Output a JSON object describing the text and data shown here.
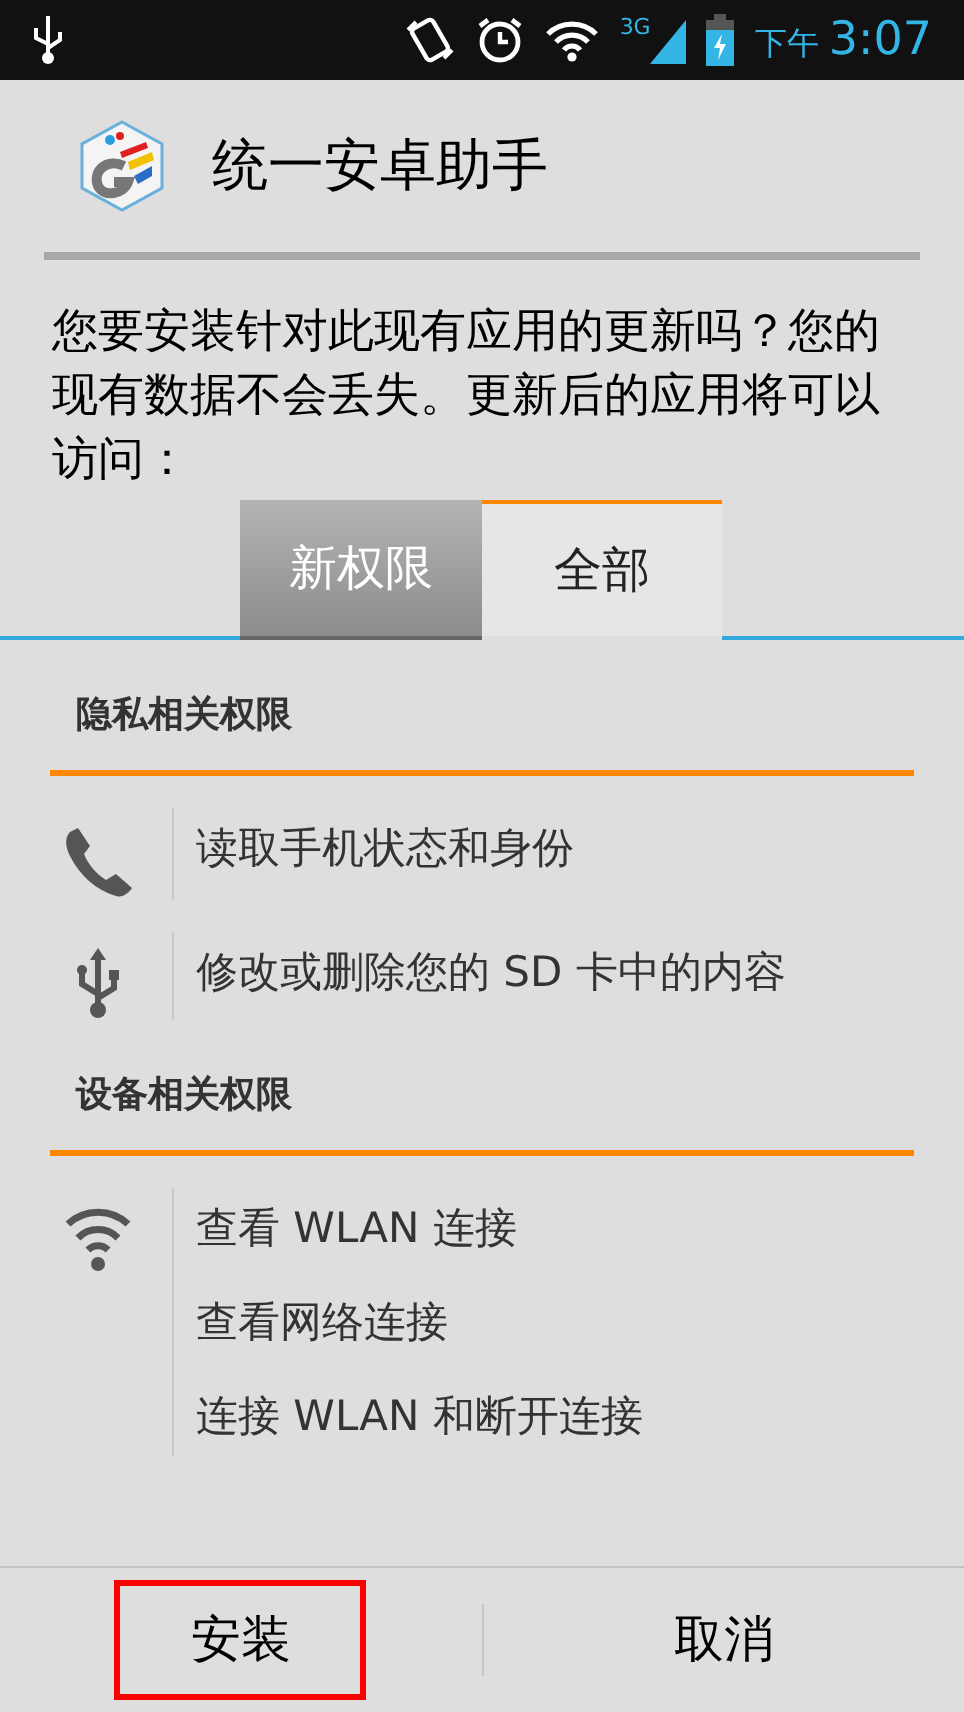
{
  "status_bar": {
    "period": "下午",
    "time": "3:07",
    "network": "3G"
  },
  "app": {
    "title": "统一安卓助手"
  },
  "message": "您要安装针对此现有应用的更新吗？您的现有数据不会丢失。更新后的应用将可以访问：",
  "tabs": [
    {
      "label": "新权限",
      "selected": true
    },
    {
      "label": "全部",
      "selected": false
    }
  ],
  "sections": [
    {
      "title": "隐私相关权限",
      "groups": [
        {
          "kind": "phone",
          "items": [
            "读取手机状态和身份"
          ]
        },
        {
          "kind": "usb",
          "items": [
            "修改或删除您的 SD 卡中的内容"
          ]
        }
      ]
    },
    {
      "title": "设备相关权限",
      "groups": [
        {
          "kind": "wifi",
          "items": [
            "查看 WLAN 连接",
            "查看网络连接",
            "连接 WLAN 和断开连接"
          ]
        }
      ]
    }
  ],
  "buttons": [
    {
      "label": "安装",
      "highlighted": true
    },
    {
      "label": "取消",
      "highlighted": false
    }
  ]
}
